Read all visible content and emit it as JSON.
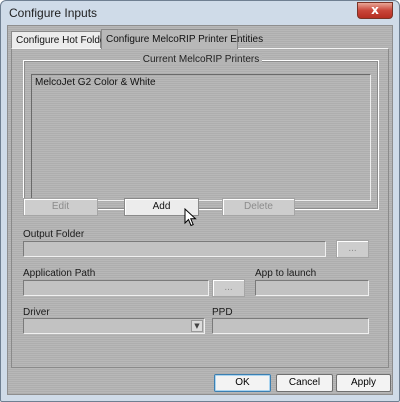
{
  "window": {
    "title": "Configure Inputs",
    "close_glyph": "x"
  },
  "tabs": [
    {
      "label": "Configure Hot Folders",
      "active": false
    },
    {
      "label": "Configure MelcoRIP Printer Entities",
      "active": true
    }
  ],
  "printers_group": {
    "label": "Current MelcoRIP Printers",
    "items": [
      "MelcoJet G2 Color & White"
    ]
  },
  "actions": {
    "edit_label": "Edit",
    "add_label": "Add",
    "delete_label": "Delete"
  },
  "output_folder": {
    "label": "Output Folder",
    "value": "",
    "browse_label": "..."
  },
  "application_path": {
    "label": "Application Path",
    "value": "",
    "browse_label": "..."
  },
  "app_to_launch": {
    "label": "App to launch",
    "value": ""
  },
  "driver": {
    "label": "Driver",
    "selected": "",
    "arrow_glyph": "▼"
  },
  "ppd": {
    "label": "PPD",
    "value": ""
  },
  "footer": {
    "ok_label": "OK",
    "cancel_label": "Cancel",
    "apply_label": "Apply"
  },
  "icons": {
    "cursor": "mouse-pointer-icon"
  }
}
